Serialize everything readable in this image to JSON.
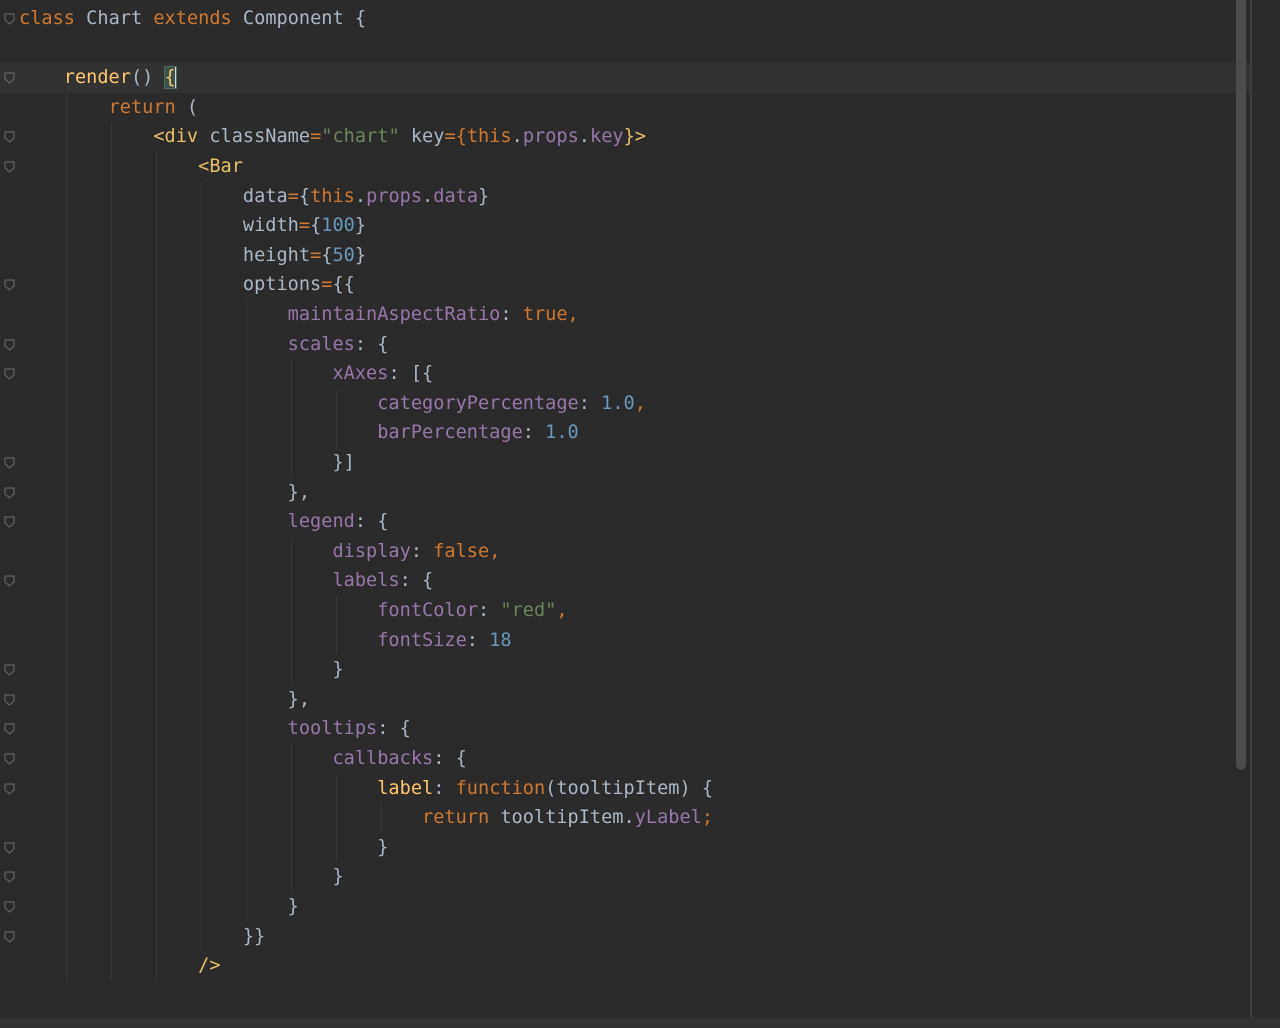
{
  "colors": {
    "background": "#2b2b2b",
    "current_line": "#323232",
    "keyword": "#cc7832",
    "identifier": "#a9b7c6",
    "function_name": "#ffc66d",
    "jsx_tag": "#e8bf6a",
    "property": "#9876aa",
    "string": "#6a8759",
    "number": "#6897bb",
    "operator": "#cc7832"
  },
  "cursor": {
    "line": 2,
    "brace_match": true
  },
  "lines": [
    {
      "fold": true,
      "tokens": [
        {
          "t": "class",
          "c": "kw"
        },
        {
          "t": " Chart ",
          "c": "id"
        },
        {
          "t": "extends",
          "c": "kw"
        },
        {
          "t": " Component {",
          "c": "id"
        }
      ]
    },
    {
      "fold": false,
      "tokens": []
    },
    {
      "fold": true,
      "current": true,
      "tokens": [
        {
          "t": "    ",
          "c": "id"
        },
        {
          "t": "render",
          "c": "fn"
        },
        {
          "t": "() ",
          "c": "id"
        },
        {
          "t": "{",
          "c": "brace"
        }
      ]
    },
    {
      "fold": false,
      "tokens": [
        {
          "t": "        ",
          "c": "id"
        },
        {
          "t": "return",
          "c": "kw"
        },
        {
          "t": " (",
          "c": "id"
        }
      ]
    },
    {
      "fold": true,
      "tokens": [
        {
          "t": "            ",
          "c": "id"
        },
        {
          "t": "<div",
          "c": "tag"
        },
        {
          "t": " className",
          "c": "id"
        },
        {
          "t": "=",
          "c": "op"
        },
        {
          "t": "\"chart\"",
          "c": "str"
        },
        {
          "t": " key",
          "c": "id"
        },
        {
          "t": "={",
          "c": "op"
        },
        {
          "t": "this",
          "c": "kw"
        },
        {
          "t": ".",
          "c": "id"
        },
        {
          "t": "props",
          "c": "prop"
        },
        {
          "t": ".",
          "c": "id"
        },
        {
          "t": "key",
          "c": "prop"
        },
        {
          "t": "}>",
          "c": "tag"
        }
      ]
    },
    {
      "fold": true,
      "tokens": [
        {
          "t": "                ",
          "c": "id"
        },
        {
          "t": "<Bar",
          "c": "tag"
        }
      ]
    },
    {
      "fold": false,
      "tokens": [
        {
          "t": "                    data",
          "c": "id"
        },
        {
          "t": "=",
          "c": "op"
        },
        {
          "t": "{",
          "c": "id"
        },
        {
          "t": "this",
          "c": "kw"
        },
        {
          "t": ".",
          "c": "id"
        },
        {
          "t": "props",
          "c": "prop"
        },
        {
          "t": ".",
          "c": "id"
        },
        {
          "t": "data",
          "c": "prop"
        },
        {
          "t": "}",
          "c": "id"
        }
      ]
    },
    {
      "fold": false,
      "tokens": [
        {
          "t": "                    width",
          "c": "id"
        },
        {
          "t": "=",
          "c": "op"
        },
        {
          "t": "{",
          "c": "id"
        },
        {
          "t": "100",
          "c": "num"
        },
        {
          "t": "}",
          "c": "id"
        }
      ]
    },
    {
      "fold": false,
      "tokens": [
        {
          "t": "                    height",
          "c": "id"
        },
        {
          "t": "=",
          "c": "op"
        },
        {
          "t": "{",
          "c": "id"
        },
        {
          "t": "50",
          "c": "num"
        },
        {
          "t": "}",
          "c": "id"
        }
      ]
    },
    {
      "fold": true,
      "tokens": [
        {
          "t": "                    options",
          "c": "id"
        },
        {
          "t": "=",
          "c": "op"
        },
        {
          "t": "{{",
          "c": "id"
        }
      ]
    },
    {
      "fold": false,
      "tokens": [
        {
          "t": "                        ",
          "c": "id"
        },
        {
          "t": "maintainAspectRatio",
          "c": "prop"
        },
        {
          "t": ": ",
          "c": "id"
        },
        {
          "t": "true,",
          "c": "kw"
        }
      ]
    },
    {
      "fold": true,
      "tokens": [
        {
          "t": "                        ",
          "c": "id"
        },
        {
          "t": "scales",
          "c": "prop"
        },
        {
          "t": ": {",
          "c": "id"
        }
      ]
    },
    {
      "fold": true,
      "tokens": [
        {
          "t": "                            ",
          "c": "id"
        },
        {
          "t": "xAxes",
          "c": "prop"
        },
        {
          "t": ": [{",
          "c": "id"
        }
      ]
    },
    {
      "fold": false,
      "tokens": [
        {
          "t": "                                ",
          "c": "id"
        },
        {
          "t": "categoryPercentage",
          "c": "prop"
        },
        {
          "t": ": ",
          "c": "id"
        },
        {
          "t": "1.0",
          "c": "num"
        },
        {
          "t": ",",
          "c": "op"
        }
      ]
    },
    {
      "fold": false,
      "tokens": [
        {
          "t": "                                ",
          "c": "id"
        },
        {
          "t": "barPercentage",
          "c": "prop"
        },
        {
          "t": ": ",
          "c": "id"
        },
        {
          "t": "1.0",
          "c": "num"
        }
      ]
    },
    {
      "fold": true,
      "tokens": [
        {
          "t": "                            }]",
          "c": "id"
        }
      ]
    },
    {
      "fold": true,
      "tokens": [
        {
          "t": "                        },",
          "c": "id"
        }
      ]
    },
    {
      "fold": true,
      "tokens": [
        {
          "t": "                        ",
          "c": "id"
        },
        {
          "t": "legend",
          "c": "prop"
        },
        {
          "t": ": {",
          "c": "id"
        }
      ]
    },
    {
      "fold": false,
      "tokens": [
        {
          "t": "                            ",
          "c": "id"
        },
        {
          "t": "display",
          "c": "prop"
        },
        {
          "t": ": ",
          "c": "id"
        },
        {
          "t": "false,",
          "c": "kw"
        }
      ]
    },
    {
      "fold": true,
      "tokens": [
        {
          "t": "                            ",
          "c": "id"
        },
        {
          "t": "labels",
          "c": "prop"
        },
        {
          "t": ": {",
          "c": "id"
        }
      ]
    },
    {
      "fold": false,
      "tokens": [
        {
          "t": "                                ",
          "c": "id"
        },
        {
          "t": "fontColor",
          "c": "prop"
        },
        {
          "t": ": ",
          "c": "id"
        },
        {
          "t": "\"red\"",
          "c": "str"
        },
        {
          "t": ",",
          "c": "op"
        }
      ]
    },
    {
      "fold": false,
      "tokens": [
        {
          "t": "                                ",
          "c": "id"
        },
        {
          "t": "fontSize",
          "c": "prop"
        },
        {
          "t": ": ",
          "c": "id"
        },
        {
          "t": "18",
          "c": "num"
        }
      ]
    },
    {
      "fold": true,
      "tokens": [
        {
          "t": "                            }",
          "c": "id"
        }
      ]
    },
    {
      "fold": true,
      "tokens": [
        {
          "t": "                        },",
          "c": "id"
        }
      ]
    },
    {
      "fold": true,
      "tokens": [
        {
          "t": "                        ",
          "c": "id"
        },
        {
          "t": "tooltips",
          "c": "prop"
        },
        {
          "t": ": {",
          "c": "id"
        }
      ]
    },
    {
      "fold": true,
      "tokens": [
        {
          "t": "                            ",
          "c": "id"
        },
        {
          "t": "callbacks",
          "c": "prop"
        },
        {
          "t": ": {",
          "c": "id"
        }
      ]
    },
    {
      "fold": true,
      "tokens": [
        {
          "t": "                                ",
          "c": "id"
        },
        {
          "t": "label",
          "c": "fn"
        },
        {
          "t": ": ",
          "c": "id"
        },
        {
          "t": "function",
          "c": "kw"
        },
        {
          "t": "(tooltipItem) {",
          "c": "id"
        }
      ]
    },
    {
      "fold": false,
      "tokens": [
        {
          "t": "                                    ",
          "c": "id"
        },
        {
          "t": "return",
          "c": "kw"
        },
        {
          "t": " tooltipItem.",
          "c": "id"
        },
        {
          "t": "yLabel",
          "c": "prop"
        },
        {
          "t": ";",
          "c": "op"
        }
      ]
    },
    {
      "fold": true,
      "tokens": [
        {
          "t": "                                }",
          "c": "id"
        }
      ]
    },
    {
      "fold": true,
      "tokens": [
        {
          "t": "                            }",
          "c": "id"
        }
      ]
    },
    {
      "fold": true,
      "tokens": [
        {
          "t": "                        }",
          "c": "id"
        }
      ]
    },
    {
      "fold": true,
      "tokens": [
        {
          "t": "                    }}",
          "c": "id"
        }
      ]
    },
    {
      "fold": false,
      "tokens": [
        {
          "t": "                ",
          "c": "id"
        },
        {
          "t": "/>",
          "c": "tag"
        }
      ]
    }
  ]
}
